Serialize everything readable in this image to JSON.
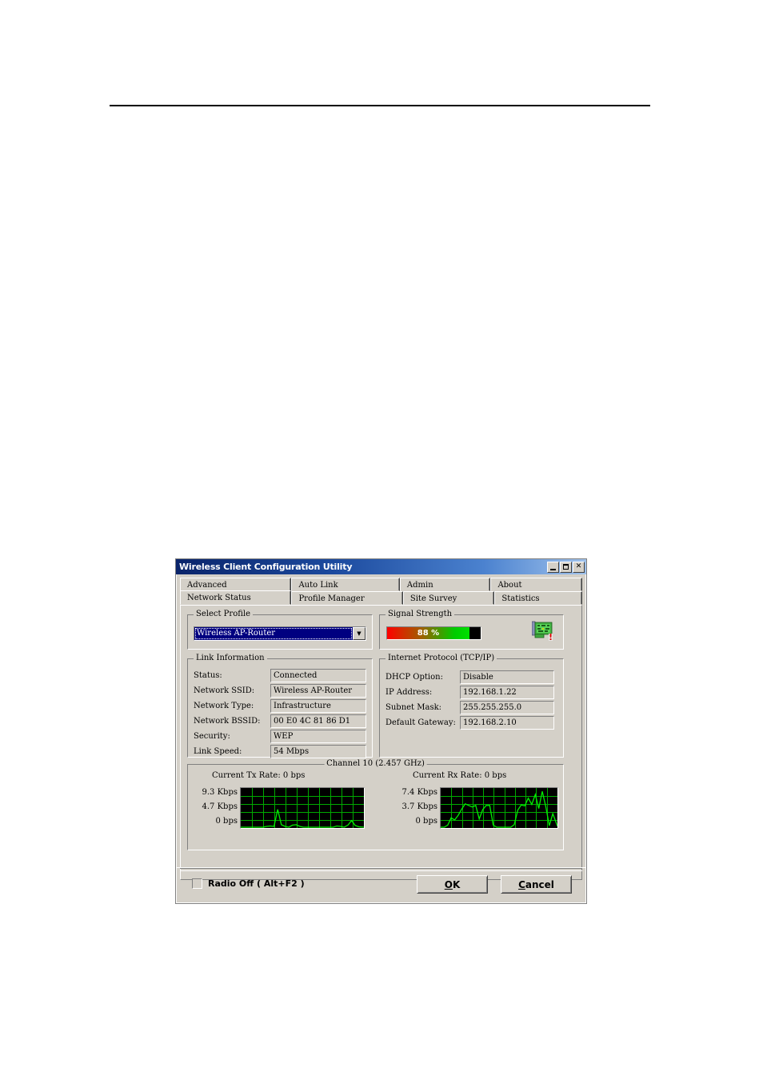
{
  "window": {
    "title": "Wireless Client Configuration Utility",
    "controls": [
      {
        "name": "minimize",
        "glyph": "_"
      },
      {
        "name": "maximize",
        "glyph": "□"
      },
      {
        "name": "close",
        "glyph": "✕"
      }
    ]
  },
  "tabs": {
    "row1": [
      {
        "label": "Advanced",
        "active": false
      },
      {
        "label": "Auto Link",
        "active": false
      },
      {
        "label": "Admin",
        "active": false
      },
      {
        "label": "About",
        "active": false
      }
    ],
    "row2": [
      {
        "label": "Network Status",
        "active": true
      },
      {
        "label": "Profile Manager",
        "active": false
      },
      {
        "label": "Site Survey",
        "active": false
      },
      {
        "label": "Statistics",
        "active": false
      }
    ]
  },
  "select_profile": {
    "title": "Select Profile",
    "value": "Wireless AP-Router",
    "arrow": "▼"
  },
  "signal_strength": {
    "title": "Signal Strength",
    "percent_label": "88 %",
    "percent_value": 88,
    "icon": "network-adapter-icon",
    "bar_start_color": "#ff0000",
    "bar_end_color": "#00e000",
    "bar_empty_color": "#000000"
  },
  "link_information": {
    "title": "Link Information",
    "rows": [
      {
        "label": "Status:",
        "value": "Connected"
      },
      {
        "label": "Network SSID:",
        "value": "Wireless AP-Router"
      },
      {
        "label": "Network Type:",
        "value": "Infrastructure"
      },
      {
        "label": "Network BSSID:",
        "value": "00 E0 4C 81 86 D1"
      },
      {
        "label": "Security:",
        "value": "WEP"
      },
      {
        "label": "Link Speed:",
        "value": "54 Mbps"
      }
    ]
  },
  "internet_protocol": {
    "title": "Internet Protocol  (TCP/IP)",
    "rows": [
      {
        "label": "DHCP Option:",
        "value": "Disable"
      },
      {
        "label": "IP Address:",
        "value": "192.168.1.22"
      },
      {
        "label": "Subnet Mask:",
        "value": "255.255.255.0"
      },
      {
        "label": "Default Gateway:",
        "value": "192.168.2.10"
      }
    ]
  },
  "channel": {
    "title": "Channel 10  (2.457 GHz)",
    "tx": {
      "rate_title": "Current Tx Rate: 0 bps",
      "y_labels": [
        "9.3 Kbps",
        "4.7 Kbps",
        "0 bps"
      ]
    },
    "rx": {
      "rate_title": "Current Rx Rate: 0 bps",
      "y_labels": [
        "7.4 Kbps",
        "3.7 Kbps",
        "0 bps"
      ]
    },
    "grid_color": "#00aa00",
    "trace_color": "#00ee00",
    "background_color": "#000000"
  },
  "chart_data": [
    {
      "type": "line",
      "title": "Current Tx Rate: 0 bps",
      "ylabel": "",
      "xlabel": "",
      "ylim": [
        0,
        9.3
      ],
      "yticks": [
        0,
        4.7,
        9.3
      ],
      "ytick_labels": [
        "0 bps",
        "4.7 Kbps",
        "9.3 Kbps"
      ],
      "grid": true,
      "x": [
        0,
        3,
        6,
        9,
        12,
        15,
        18,
        21,
        24,
        27,
        30,
        33,
        36,
        39,
        42,
        45,
        48,
        51,
        54,
        57,
        60,
        63,
        66,
        69,
        72,
        75,
        78,
        81,
        84,
        87,
        90,
        93,
        96,
        100
      ],
      "values": [
        0,
        0,
        0,
        0,
        0,
        0,
        0,
        0.2,
        0.3,
        0.2,
        4.3,
        0.6,
        0.2,
        0,
        0.5,
        0.6,
        0.2,
        0,
        0,
        0,
        0,
        0,
        0,
        0,
        0,
        0,
        0.3,
        0.2,
        0,
        0.5,
        1.6,
        0.4,
        0.1,
        0
      ]
    },
    {
      "type": "line",
      "title": "Current Rx Rate: 0 bps",
      "ylabel": "",
      "xlabel": "",
      "ylim": [
        0,
        7.4
      ],
      "yticks": [
        0,
        3.7,
        7.4
      ],
      "ytick_labels": [
        "0 bps",
        "3.7 Kbps",
        "7.4 Kbps"
      ],
      "grid": true,
      "x": [
        0,
        3,
        6,
        9,
        12,
        15,
        18,
        21,
        24,
        27,
        30,
        33,
        36,
        39,
        42,
        45,
        48,
        51,
        54,
        57,
        60,
        63,
        66,
        69,
        72,
        75,
        78,
        81,
        84,
        87,
        90,
        93,
        96,
        100
      ],
      "values": [
        0,
        0,
        0.4,
        1.8,
        1.4,
        2.3,
        3.5,
        4.5,
        4.2,
        3.9,
        4.2,
        1.6,
        3.4,
        4.2,
        4.2,
        0.4,
        0,
        0,
        0,
        0,
        0,
        0.5,
        3.3,
        4.3,
        4.1,
        5.6,
        4.4,
        6.3,
        3.6,
        6.9,
        4.0,
        0.3,
        2.6,
        0.2
      ]
    }
  ],
  "footer": {
    "radio_off_label": "Radio Off  ( Alt+F2 )",
    "radio_off_checked": false,
    "ok_label": "OK",
    "ok_accel": "O",
    "cancel_label": "Cancel",
    "cancel_accel": "C"
  }
}
